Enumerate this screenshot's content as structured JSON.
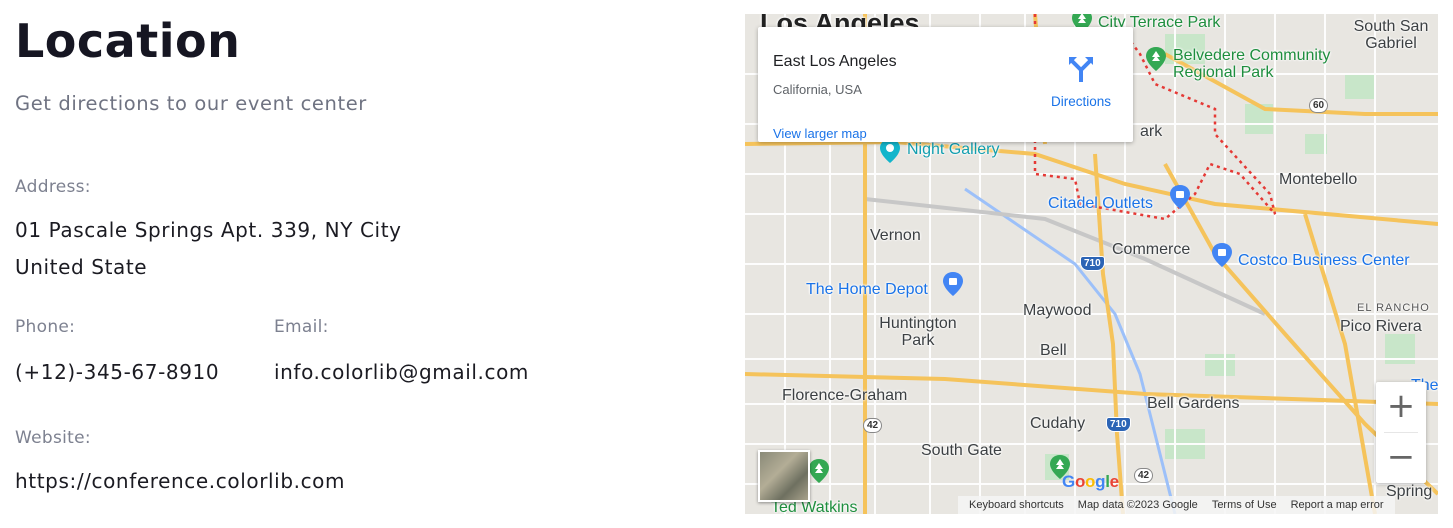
{
  "heading": {
    "title": "Location",
    "subtitle": "Get directions to our event center"
  },
  "contact": {
    "address_label": "Address:",
    "address_line1": "01 Pascale Springs Apt. 339, NY City",
    "address_line2": "United State",
    "phone_label": "Phone:",
    "phone_value": "(+12)-345-67-8910",
    "email_label": "Email:",
    "email_value": "info.colorlib@gmail.com",
    "website_label": "Website:",
    "website_value": "https://conference.colorlib.com"
  },
  "map": {
    "card": {
      "place_name": "East Los Angeles",
      "place_region": "California, USA",
      "directions_label": "Directions",
      "view_larger_label": "View larger map",
      "directions_icon": "directions-icon"
    },
    "labels": {
      "los_angeles": "Los Angeles",
      "city_terrace_park": "City Terrace Park",
      "south_san_gabriel": "South San Gabriel",
      "belvedere_park": "Belvedere Community Regional Park",
      "night_gallery": "Night Gallery",
      "ark": "ark",
      "montebello": "Montebello",
      "citadel_outlets": "Citadel Outlets",
      "vernon": "Vernon",
      "commerce": "Commerce",
      "costco": "Costco Business Center",
      "home_depot": "The Home Depot",
      "maywood": "Maywood",
      "el_rancho": "EL RANCHO",
      "pico_rivera": "Pico Rivera",
      "huntington_park": "Huntington Park",
      "bell": "Bell",
      "florence_graham": "Florence-Graham",
      "bell_gardens": "Bell Gardens",
      "cudahy": "Cudahy",
      "south_gate": "South Gate",
      "ted_watkins": "Ted Watkins",
      "santa_fe_springs": "Spring",
      "the": "The"
    },
    "route_shields": {
      "r60": "60",
      "r710a": "710",
      "r710b": "710",
      "r42a": "42",
      "r42b": "42"
    },
    "controls": {
      "zoom_in": "+",
      "zoom_out": "−"
    },
    "google_logo": "Google",
    "footer": {
      "shortcuts": "Keyboard shortcuts",
      "map_data": "Map data ©2023 Google",
      "terms": "Terms of Use",
      "report": "Report a map error"
    },
    "colors": {
      "park": "#c8e6c9",
      "highway": "#f5c35b",
      "boundary": "#e53935",
      "water": "#9cc0f9",
      "link": "#1a73e8"
    }
  }
}
